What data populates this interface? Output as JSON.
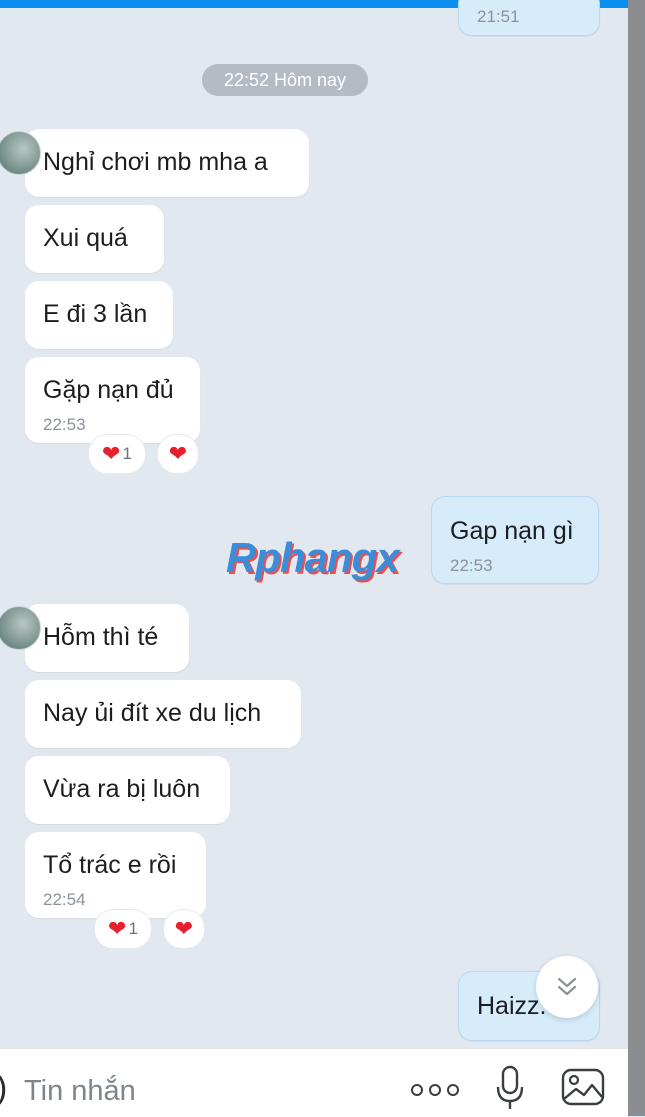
{
  "colors": {
    "accent": "#0a8ef0",
    "incoming_bubble": "#ffffff",
    "outgoing_bubble": "#d6ecfb",
    "heart": "#e8202e"
  },
  "top_partial": {
    "time": "21:51"
  },
  "date_divider": "22:52 Hôm nay",
  "group1": {
    "messages": [
      "Nghỉ chơi mb mha a",
      "Xui quá",
      "E đi 3 lần",
      "Gặp nạn đủ"
    ],
    "time": "22:53",
    "reaction_count": "1"
  },
  "outgoing1": {
    "text": "Gap nạn gì",
    "time": "22:53"
  },
  "watermark": "Rphangx",
  "group2": {
    "messages": [
      "Hỗm thì té",
      "Nay ủi đít xe du lịch",
      "Vừa ra bị luôn",
      "Tổ trác e rồi"
    ],
    "time": "22:54",
    "reaction_count": "1"
  },
  "outgoing2": {
    "text": "Haizz."
  },
  "input": {
    "placeholder": "Tin nhắn"
  },
  "icons": [
    "chevron-down-double-icon",
    "more-dots-icon",
    "microphone-icon",
    "image-icon",
    "heart-icon"
  ]
}
